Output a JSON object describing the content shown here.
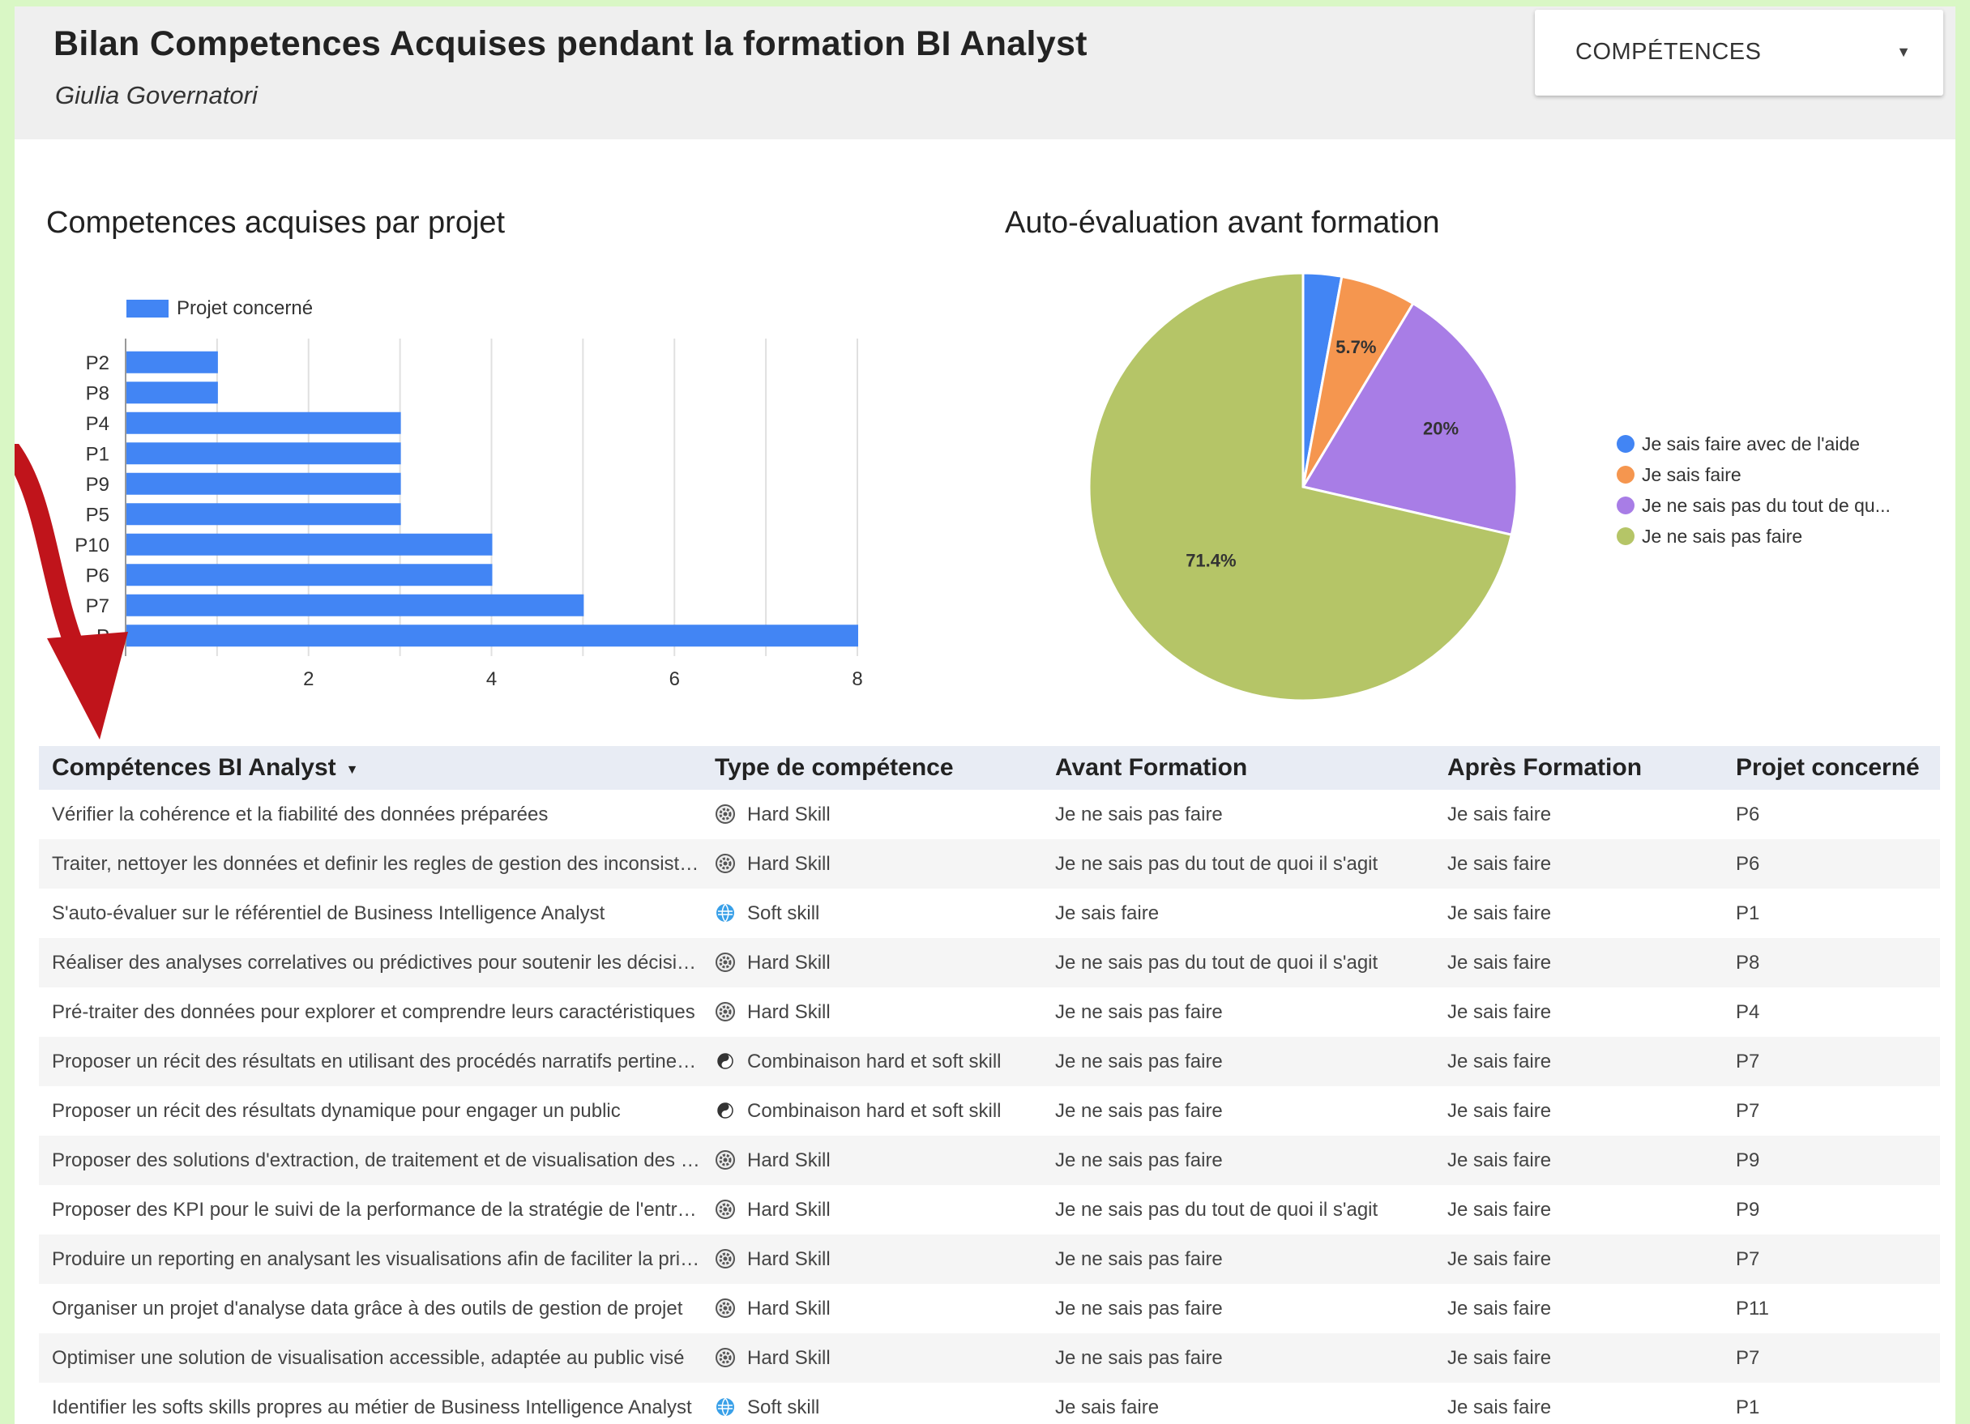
{
  "header": {
    "title": "Bilan Competences Acquises pendant la formation BI Analyst",
    "subtitle": "Giulia Governatori",
    "filter_label": "COMPÉTENCES"
  },
  "bar_chart_title": "Competences acquises par projet",
  "pie_chart_title": "Auto-évaluation avant formation",
  "chart_data": [
    {
      "type": "bar",
      "orientation": "horizontal",
      "title": "Competences acquises par projet",
      "categories": [
        "P2",
        "P8",
        "P4",
        "P1",
        "P9",
        "P5",
        "P10",
        "P6",
        "P7",
        "P"
      ],
      "series": [
        {
          "name": "Projet concerné",
          "color": "#4285f4",
          "values": [
            1,
            1,
            3,
            3,
            3,
            3,
            4,
            4,
            5,
            8
          ]
        }
      ],
      "xticks": [
        2,
        4,
        6,
        8
      ],
      "xlim": [
        0,
        8
      ],
      "grid": true,
      "legend_position": "top"
    },
    {
      "type": "pie",
      "title": "Auto-évaluation avant formation",
      "labels": [
        "Je sais faire avec de l'aide",
        "Je sais faire",
        "Je ne sais pas du tout de qu...",
        "Je ne sais pas faire"
      ],
      "values": [
        2.9,
        5.7,
        20,
        71.4
      ],
      "data_labels": [
        "",
        "5.7%",
        "20%",
        "71.4%"
      ],
      "colors": [
        "#4285f4",
        "#f5964f",
        "#a87de6",
        "#b5c567"
      ],
      "legend_position": "right"
    }
  ],
  "table": {
    "headers": [
      "Compétences BI Analyst",
      "Type de compétence",
      "Avant Formation",
      "Après Formation",
      "Projet concerné"
    ],
    "rows": [
      [
        "Vérifier la cohérence et la fiabilité des données préparées",
        "Hard Skill",
        "Je ne sais pas faire",
        "Je sais faire",
        "P6"
      ],
      [
        "Traiter, nettoyer les données et definir les regles de gestion des inconsistances",
        "Hard Skill",
        "Je ne sais pas du tout de quoi il s'agit",
        "Je sais faire",
        "P6"
      ],
      [
        "S'auto-évaluer sur le référentiel de Business Intelligence Analyst",
        "Soft skill",
        "Je sais faire",
        "Je sais faire",
        "P1"
      ],
      [
        "Réaliser des analyses correlatives ou prédictives pour soutenir les décisions",
        "Hard Skill",
        "Je ne sais pas du tout de quoi il s'agit",
        "Je sais faire",
        "P8"
      ],
      [
        "Pré-traiter des données pour explorer et comprendre leurs caractéristiques",
        "Hard Skill",
        "Je ne sais pas faire",
        "Je sais faire",
        "P4"
      ],
      [
        "Proposer un récit des résultats en utilisant des procédés narratifs pertinents",
        "Combinaison hard et soft skill",
        "Je ne sais pas faire",
        "Je sais faire",
        "P7"
      ],
      [
        "Proposer un récit des résultats dynamique pour engager un public",
        "Combinaison hard et soft skill",
        "Je ne sais pas faire",
        "Je sais faire",
        "P7"
      ],
      [
        "Proposer des solutions d'extraction, de traitement et de visualisation des données",
        "Hard Skill",
        "Je ne sais pas faire",
        "Je sais faire",
        "P9"
      ],
      [
        "Proposer des KPI pour le suivi de la performance de la stratégie de l'entreprise",
        "Hard Skill",
        "Je ne sais pas du tout de quoi il s'agit",
        "Je sais faire",
        "P9"
      ],
      [
        "Produire un reporting en analysant les visualisations afin de faciliter la prise de décision",
        "Hard Skill",
        "Je ne sais pas faire",
        "Je sais faire",
        "P7"
      ],
      [
        "Organiser un projet d'analyse data grâce à des outils de gestion de projet",
        "Hard Skill",
        "Je ne sais pas faire",
        "Je sais faire",
        "P11"
      ],
      [
        "Optimiser une solution de visualisation accessible, adaptée au public visé",
        "Hard Skill",
        "Je ne sais pas faire",
        "Je sais faire",
        "P7"
      ],
      [
        "Identifier les softs skills propres au métier de Business Intelligence Analyst",
        "Soft skill",
        "Je sais faire",
        "Je sais faire",
        "P1"
      ]
    ]
  }
}
